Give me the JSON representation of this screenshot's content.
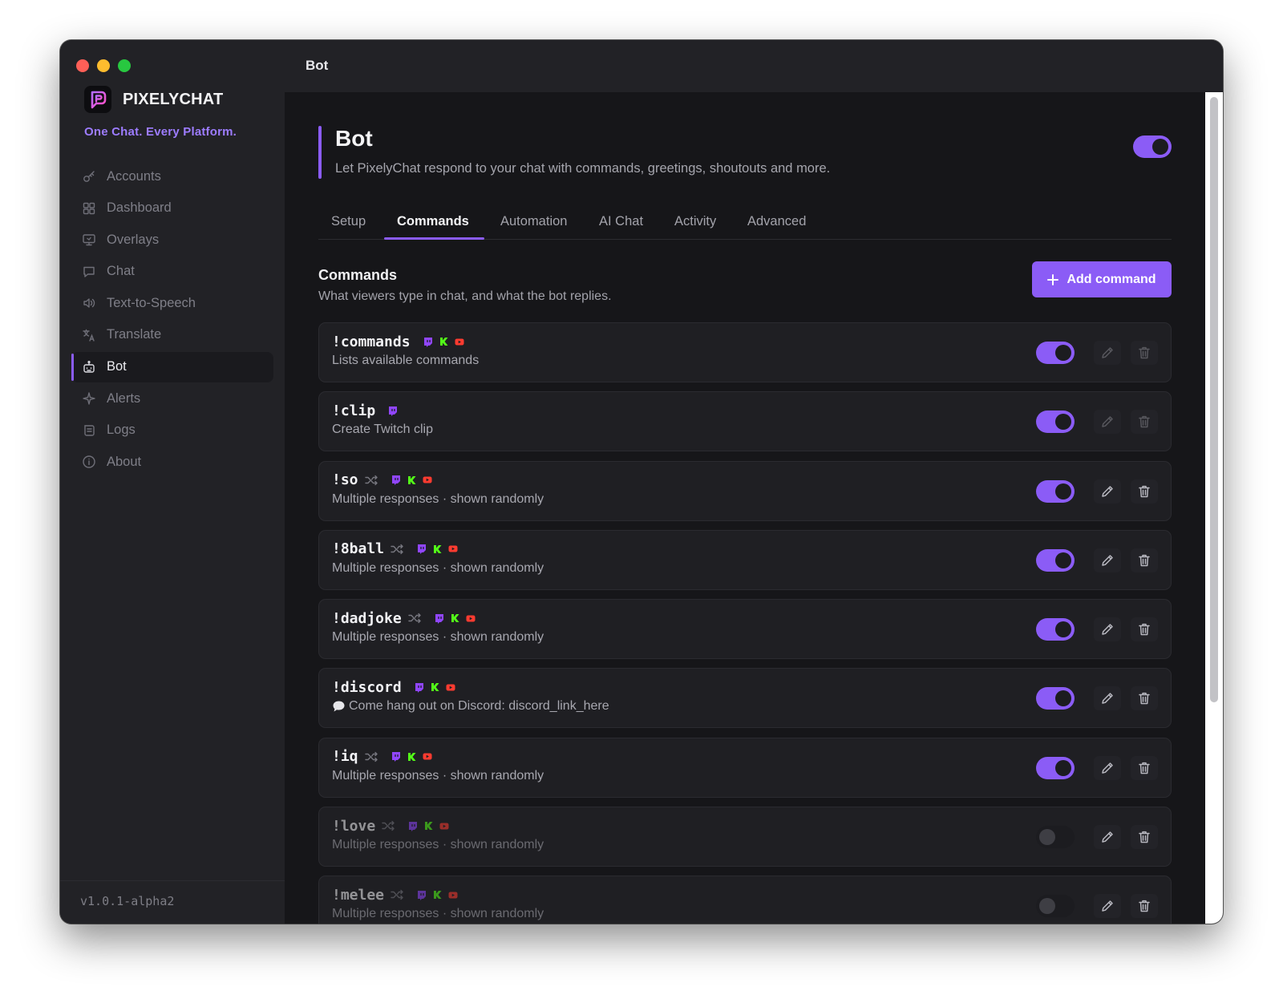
{
  "app": {
    "brand_name": "PIXELYCHAT",
    "tagline": "One Chat. Every Platform.",
    "window_title": "Bot",
    "version": "v1.0.1-alpha2"
  },
  "sidebar": {
    "items": [
      {
        "label": "Accounts",
        "icon": "key-icon",
        "active": false
      },
      {
        "label": "Dashboard",
        "icon": "grid-icon",
        "active": false
      },
      {
        "label": "Overlays",
        "icon": "monitor-icon",
        "active": false
      },
      {
        "label": "Chat",
        "icon": "chat-bubble-icon",
        "active": false
      },
      {
        "label": "Text-to-Speech",
        "icon": "speaker-icon",
        "active": false
      },
      {
        "label": "Translate",
        "icon": "translate-icon",
        "active": false
      },
      {
        "label": "Bot",
        "icon": "robot-icon",
        "active": true
      },
      {
        "label": "Alerts",
        "icon": "sparkle-icon",
        "active": false
      },
      {
        "label": "Logs",
        "icon": "scroll-icon",
        "active": false
      },
      {
        "label": "About",
        "icon": "info-icon",
        "active": false
      }
    ]
  },
  "header": {
    "title": "Bot",
    "subtitle": "Let PixelyChat respond to your chat with commands, greetings, shoutouts and more.",
    "enabled": true
  },
  "tabs": [
    {
      "label": "Setup",
      "active": false
    },
    {
      "label": "Commands",
      "active": true
    },
    {
      "label": "Automation",
      "active": false
    },
    {
      "label": "AI Chat",
      "active": false
    },
    {
      "label": "Activity",
      "active": false
    },
    {
      "label": "Advanced",
      "active": false
    }
  ],
  "section": {
    "title": "Commands",
    "subtitle": "What viewers type in chat, and what the bot replies.",
    "add_label": "Add command"
  },
  "colors": {
    "accent": "#8b5cf6",
    "twitch": "#9146ff",
    "kick": "#53fc18",
    "youtube": "#ff3b30"
  },
  "commands": [
    {
      "name": "!commands",
      "random": false,
      "platforms": [
        "twitch",
        "kick",
        "youtube"
      ],
      "desc": "Lists available commands",
      "speech": false,
      "enabled": true,
      "editable": false
    },
    {
      "name": "!clip",
      "random": false,
      "platforms": [
        "twitch"
      ],
      "desc": "Create Twitch clip",
      "speech": false,
      "enabled": true,
      "editable": false
    },
    {
      "name": "!so",
      "random": true,
      "platforms": [
        "twitch",
        "kick",
        "youtube"
      ],
      "desc": "Multiple responses · shown randomly",
      "speech": false,
      "enabled": true,
      "editable": true
    },
    {
      "name": "!8ball",
      "random": true,
      "platforms": [
        "twitch",
        "kick",
        "youtube"
      ],
      "desc": "Multiple responses · shown randomly",
      "speech": false,
      "enabled": true,
      "editable": true
    },
    {
      "name": "!dadjoke",
      "random": true,
      "platforms": [
        "twitch",
        "kick",
        "youtube"
      ],
      "desc": "Multiple responses · shown randomly",
      "speech": false,
      "enabled": true,
      "editable": true
    },
    {
      "name": "!discord",
      "random": false,
      "platforms": [
        "twitch",
        "kick",
        "youtube"
      ],
      "desc": "Come hang out on Discord: discord_link_here",
      "speech": true,
      "enabled": true,
      "editable": true
    },
    {
      "name": "!iq",
      "random": true,
      "platforms": [
        "twitch",
        "kick",
        "youtube"
      ],
      "desc": "Multiple responses · shown randomly",
      "speech": false,
      "enabled": true,
      "editable": true
    },
    {
      "name": "!love",
      "random": true,
      "platforms": [
        "twitch",
        "kick",
        "youtube"
      ],
      "desc": "Multiple responses · shown randomly",
      "speech": false,
      "enabled": false,
      "editable": true
    },
    {
      "name": "!melee",
      "random": true,
      "platforms": [
        "twitch",
        "kick",
        "youtube"
      ],
      "desc": "Multiple responses · shown randomly",
      "speech": false,
      "enabled": false,
      "editable": true
    }
  ]
}
